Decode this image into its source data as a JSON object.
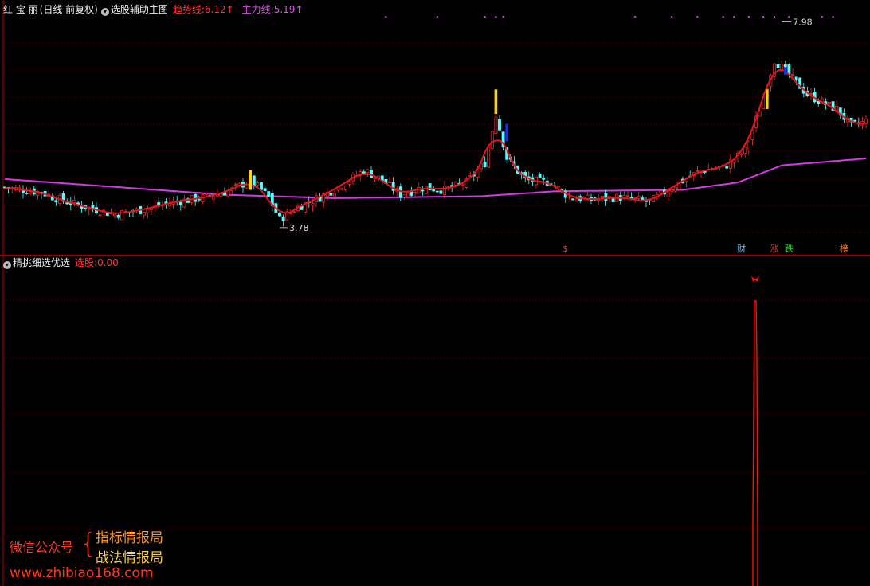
{
  "top_header": {
    "stock_name": "红 宝 丽",
    "period": "(日线 前复权)",
    "indicator_name": "选股辅助主图",
    "trend_label": "趋势线:",
    "trend_value": "6.12",
    "trend_arrow": "↑",
    "main_label": "主力线:",
    "main_value": "5.19",
    "main_arrow": "↑"
  },
  "bottom_header": {
    "indicator_name": "精挑细选优选",
    "signal_label": "选股:",
    "signal_value": "0.00"
  },
  "annotations": {
    "high_label": "7.98",
    "low_label": "3.78",
    "markers": [
      "$",
      "财",
      "涨",
      "跌",
      "榜"
    ]
  },
  "watermark": {
    "prefix": "微信公众号",
    "line1": "指标情报局",
    "line2": "战法情报局",
    "url": "www.zhibiao168.com"
  },
  "colors": {
    "background": "#000000",
    "up_candle": "#ff3030",
    "down_candle": "#54ffff",
    "trend_line": "#e8141c",
    "main_line": "#d838e6",
    "grid": "#7a0000",
    "signal": "#ff1010",
    "alert_bar": "#ffd700",
    "blue_bar": "#1a2cff"
  },
  "chart_data": [
    {
      "type": "candlestick",
      "title": "选股辅助主图",
      "series": [
        {
          "name": "趋势线",
          "last_value": 6.12
        },
        {
          "name": "主力线",
          "last_value": 5.19
        }
      ],
      "price_range": [
        3.55,
        8.1
      ],
      "marked_high": 7.98,
      "marked_low": 3.78,
      "close_path": [
        {
          "i": 0,
          "v": 4.6
        },
        {
          "i": 10,
          "v": 4.5
        },
        {
          "i": 15,
          "v": 4.35
        },
        {
          "i": 22,
          "v": 4.2
        },
        {
          "i": 30,
          "v": 4.05
        },
        {
          "i": 38,
          "v": 4.15
        },
        {
          "i": 46,
          "v": 4.3
        },
        {
          "i": 55,
          "v": 4.4
        },
        {
          "i": 62,
          "v": 4.55
        },
        {
          "i": 67,
          "v": 4.75
        },
        {
          "i": 72,
          "v": 4.4
        },
        {
          "i": 75,
          "v": 3.95
        },
        {
          "i": 80,
          "v": 4.2
        },
        {
          "i": 86,
          "v": 4.4
        },
        {
          "i": 92,
          "v": 4.65
        },
        {
          "i": 98,
          "v": 4.95
        },
        {
          "i": 103,
          "v": 4.75
        },
        {
          "i": 108,
          "v": 4.45
        },
        {
          "i": 114,
          "v": 4.6
        },
        {
          "i": 120,
          "v": 4.55
        },
        {
          "i": 126,
          "v": 4.7
        },
        {
          "i": 131,
          "v": 5.1
        },
        {
          "i": 134,
          "v": 6.1
        },
        {
          "i": 137,
          "v": 5.2
        },
        {
          "i": 142,
          "v": 4.75
        },
        {
          "i": 149,
          "v": 4.7
        },
        {
          "i": 154,
          "v": 4.4
        },
        {
          "i": 160,
          "v": 4.35
        },
        {
          "i": 168,
          "v": 4.4
        },
        {
          "i": 176,
          "v": 4.3
        },
        {
          "i": 183,
          "v": 4.65
        },
        {
          "i": 190,
          "v": 4.95
        },
        {
          "i": 196,
          "v": 5.0
        },
        {
          "i": 202,
          "v": 5.35
        },
        {
          "i": 206,
          "v": 6.2
        },
        {
          "i": 210,
          "v": 7.2
        },
        {
          "i": 214,
          "v": 6.9
        },
        {
          "i": 219,
          "v": 6.5
        },
        {
          "i": 224,
          "v": 6.3
        },
        {
          "i": 227,
          "v": 6.2
        },
        {
          "i": 231,
          "v": 5.85
        },
        {
          "i": 235,
          "v": 5.95
        }
      ],
      "main_line_path": [
        {
          "i": 0,
          "v": 4.77
        },
        {
          "i": 60,
          "v": 4.45
        },
        {
          "i": 90,
          "v": 4.38
        },
        {
          "i": 130,
          "v": 4.42
        },
        {
          "i": 150,
          "v": 4.52
        },
        {
          "i": 185,
          "v": 4.55
        },
        {
          "i": 200,
          "v": 4.7
        },
        {
          "i": 212,
          "v": 5.05
        },
        {
          "i": 235,
          "v": 5.19
        }
      ]
    },
    {
      "type": "line",
      "title": "精挑细选优选",
      "series": [
        {
          "name": "选股",
          "last_value": 0.0
        }
      ],
      "signal_bar_index": 205
    }
  ]
}
